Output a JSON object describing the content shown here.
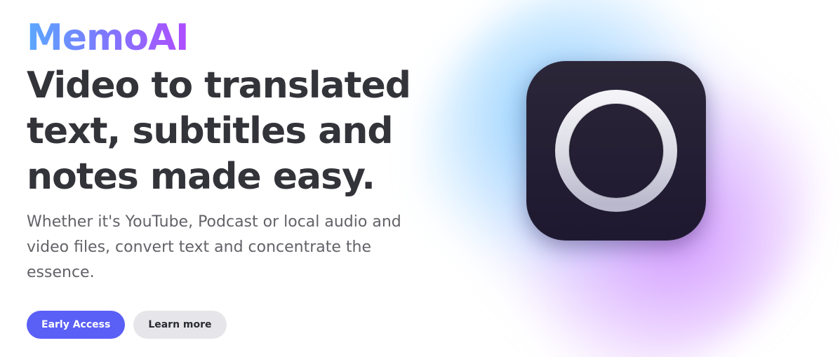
{
  "hero": {
    "brand": "MemoAI",
    "headline": "Video to translated\ntext, subtitles and\nnotes made easy.",
    "subtitle": "Whether it's YouTube, Podcast or local audio and video files, convert text and concentrate the essence.",
    "buttons": {
      "primary_label": "Early Access",
      "secondary_label": "Learn more"
    },
    "app_icon": "ring-icon"
  },
  "colors": {
    "brand_gradient_start": "#5aa8ff",
    "brand_gradient_end": "#b04cff",
    "primary_button": "#5a5ff6",
    "secondary_button": "#e6e6ea",
    "headline_text": "#33333a",
    "icon_background": "#231e33"
  }
}
